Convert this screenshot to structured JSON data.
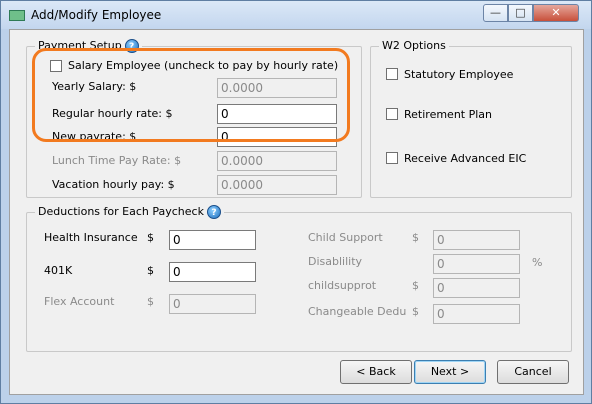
{
  "window": {
    "title": "Add/Modify Employee",
    "min_glyph": "—",
    "max_glyph": "□",
    "close_glyph": "✕"
  },
  "payment_setup": {
    "legend": "Payment Setup",
    "help_glyph": "?",
    "salary_checkbox_label": "Salary Employee (uncheck to pay by hourly rate)",
    "salary_checked": false,
    "yearly_salary_label": "Yearly Salary: $",
    "yearly_salary_value": "0.0000",
    "regular_rate_label": "Regular hourly rate: $",
    "regular_rate_value": "0",
    "new_payrate_label": "New payrate: $",
    "new_payrate_value": "0",
    "lunch_rate_label": "Lunch Time Pay Rate: $",
    "lunch_rate_value": "0.0000",
    "vacation_label": "Vacation hourly pay: $",
    "vacation_value": "0.0000"
  },
  "w2_options": {
    "legend": "W2 Options",
    "statutory_label": "Statutory Employee",
    "retirement_label": "Retirement Plan",
    "eic_label": "Receive Advanced EIC"
  },
  "deductions": {
    "legend": "Deductions for Each Paycheck",
    "help_glyph": "?",
    "health_label": "Health Insurance",
    "health_currency": "$",
    "health_value": "0",
    "k401_label": "401K",
    "k401_currency": "$",
    "k401_value": "0",
    "flex_label": "Flex Account",
    "flex_currency": "$",
    "flex_value": "0",
    "child_support_label": "Child Support",
    "child_support_currency": "$",
    "child_support_value": "0",
    "disability_label": "Disablility",
    "disability_value": "0",
    "disability_unit": "%",
    "childsupprot_label": "childsupprot",
    "childsupprot_currency": "$",
    "childsupprot_value": "0",
    "changeable_label": "Changeable Dedu",
    "changeable_currency": "$",
    "changeable_value": "0"
  },
  "buttons": {
    "back": "< Back",
    "next": "Next >",
    "cancel": "Cancel"
  },
  "colors": {
    "highlight": "#f27a1f",
    "window_frame": "#bcd1ea"
  }
}
